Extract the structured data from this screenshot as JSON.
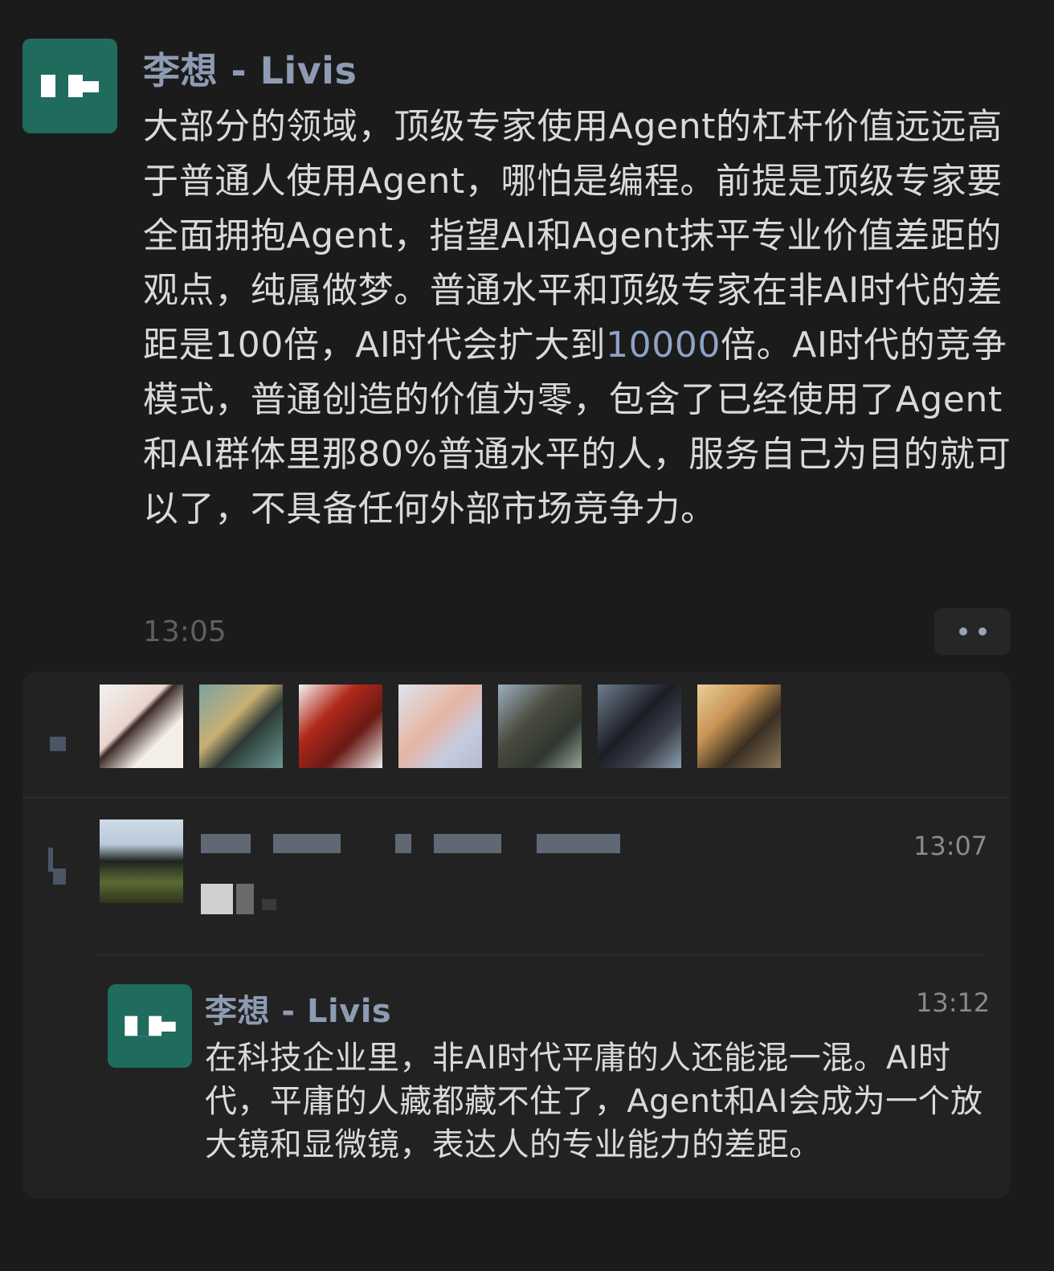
{
  "post": {
    "author": "李想 - Livis",
    "text_before_highlight": "大部分的领域，顶级专家使用Agent的杠杆价值远远高于普通人使用Agent，哪怕是编程。前提是顶级专家要全面拥抱Agent，指望AI和Agent抹平专业价值差距的观点，纯属做梦。普通水平和顶级专家在非AI时代的差距是100倍，AI时代会扩大到",
    "highlight_number": "10000",
    "text_after_highlight": "倍。AI时代的竞争模式，普通创造的价值为零，包含了已经使用了Agent和AI群体里那80%普通水平的人，服务自己为目的就可以了，不具备任何外部市场竞争力。",
    "time": "13:05",
    "avatar_icon": "li-auto-logo-icon",
    "more_icon": "more-dots-icon"
  },
  "likes": {
    "icon": "like-icon"
  },
  "comments": [
    {
      "time": "13:07"
    }
  ],
  "reply": {
    "author": "李想 - Livis",
    "time": "13:12",
    "text": "在科技企业里，非AI时代平庸的人还能混一混。AI时代，平庸的人藏都藏不住了，Agent和AI会成为一个放大镜和显微镜，表达人的专业能力的差距。"
  },
  "colors": {
    "background": "#1b1b1b",
    "panel": "#222222",
    "avatar": "#1f6b5d",
    "author_name": "#8e9cb3",
    "link_number": "#8ea3c5"
  }
}
